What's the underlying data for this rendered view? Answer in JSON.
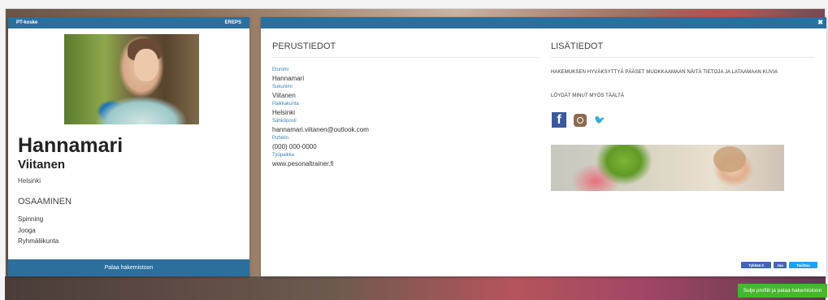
{
  "card": {
    "header_left": "PT-koske",
    "header_right": "EREPS",
    "first_name": "Hannamari",
    "last_name": "Viitanen",
    "city": "Helsinki",
    "skills_title": "OSAAMINEN",
    "skills": [
      "Spinning",
      "Jooga",
      "Ryhmäliikunta"
    ],
    "back_button": "Palaa hakemistoon"
  },
  "basic_info": {
    "title": "PERUSTIEDOT",
    "fields": [
      {
        "label": "Etunimi",
        "value": "Hannamari"
      },
      {
        "label": "Sukunimi",
        "value": "Viitanen"
      },
      {
        "label": "Paikkakunta",
        "value": "Helsinki"
      },
      {
        "label": "Sähköposti",
        "value": "hannamari.viitanen@outlook.com"
      },
      {
        "label": "Puhelin",
        "value": "(000) 000-0000"
      },
      {
        "label": "Työpaikka",
        "value": "www.pesonaltrainer.fi"
      }
    ]
  },
  "extra_info": {
    "title": "LISÄTIEDOT",
    "approval_text": "HAKEMUKSEN HYVÄKSYTTYÄ PÄÄSET MUOKKAAMAAN NÄITÄ TIETOJA JA LATAAMAAN KUVIA",
    "find_me_text": "LÖYDÄT MINUT MYÖS TÄÄLTÄ",
    "social_icons": [
      "facebook-icon",
      "instagram-icon",
      "twitter-icon"
    ]
  },
  "share": {
    "like": "Tykkää 0",
    "share": "Jaa",
    "tweet": "Twiittaa"
  },
  "close_button": "Sulje profiili ja palaa hakemistoon",
  "colors": {
    "header_blue": "#2b6f9e",
    "label_blue": "#3a7fb5",
    "close_green": "#46b72c",
    "facebook": "#3b5998",
    "twitter": "#3aa3e3"
  }
}
